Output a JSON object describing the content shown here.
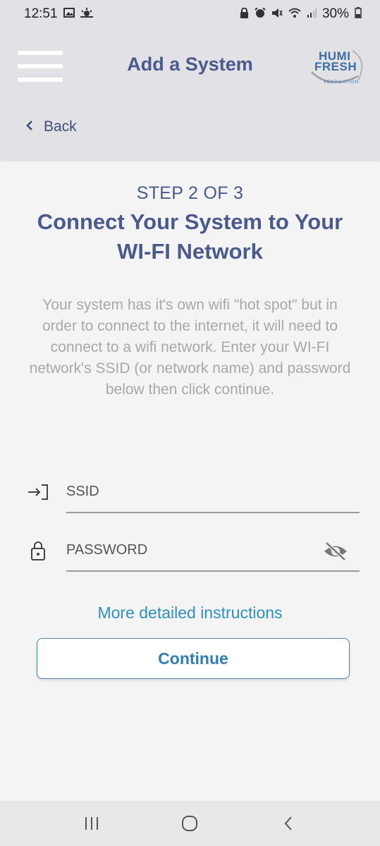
{
  "status_bar": {
    "time": "12:51",
    "battery": "30%",
    "left_icons": [
      "gallery-icon",
      "weather-icon"
    ],
    "right_icons": [
      "lock-icon",
      "alarm-icon",
      "mute-icon",
      "wifi-icon",
      "signal-icon",
      "battery-icon"
    ]
  },
  "header": {
    "title": "Add a System",
    "logo_line1": "HUMI",
    "logo_line2": "FRESH",
    "logo_tagline": "VENTILATION",
    "back_label": "Back"
  },
  "step": {
    "label": "STEP 2 OF 3",
    "title": "Connect Your System to Your WI-FI Network",
    "description": "Your system has it's own wifi \"hot spot\" but in order to connect to the internet, it will need to connect to a wifi network. Enter your WI-FI network's SSID (or network name) and password below then click continue."
  },
  "form": {
    "ssid_placeholder": "SSID",
    "password_placeholder": "PASSWORD"
  },
  "actions": {
    "more_instructions": "More detailed instructions",
    "continue_label": "Continue"
  },
  "colors": {
    "header_bg": "#e2e2e6",
    "title_color": "#4a5a8c",
    "link_color": "#2e8fc1",
    "page_bg": "#f4f4f4"
  }
}
